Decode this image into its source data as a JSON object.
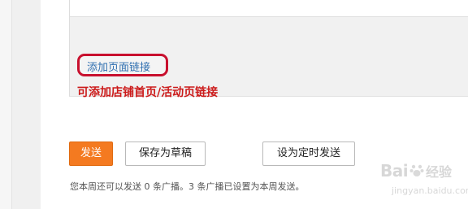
{
  "editor": {
    "add_link_label": "添加页面链接",
    "hint_text": "可添加店铺首页/活动页链接"
  },
  "actions": {
    "send_label": "发送",
    "save_draft_label": "保存为草稿",
    "schedule_label": "设为定时发送"
  },
  "status": {
    "text": "您本周还可以发送 0 条广播。3 条广播已设置为本周发送。"
  },
  "watermark": {
    "brand": "Bai",
    "brand_cn": "经验",
    "url": "jingyan.baidu.com"
  },
  "colors": {
    "send_button": "#f47a20",
    "highlight_ring": "#c8102e",
    "hint": "#cc1b1b",
    "link": "#2f6fb0"
  }
}
